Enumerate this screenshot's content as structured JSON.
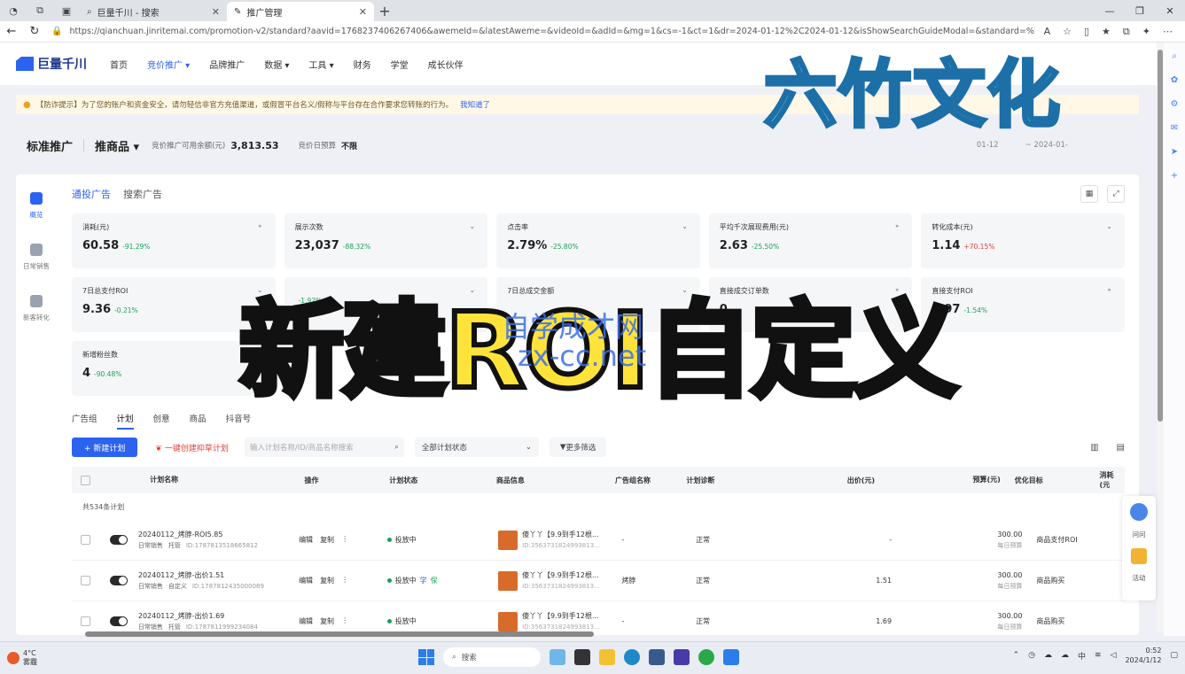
{
  "browser": {
    "tabs": [
      {
        "label": "巨量千川 - 搜索",
        "active": false
      },
      {
        "label": "推广管理",
        "active": true
      }
    ],
    "url": "https://qianchuan.jinritemai.com/promotion-v2/standard?aavid=1768237406267406&awemeId=&latestAweme=&videoId=&adId=&mg=1&cs=-1&ct=1&dr=2024-01-12%2C2024-01-12&isShowSearchGuideModal=&standard=%7B\"t..."
  },
  "app": {
    "logo_text": "巨量千川",
    "menu": [
      "首页",
      "竞价推广 ▾",
      "品牌推广",
      "数据 ▾",
      "工具 ▾",
      "财务",
      "学堂",
      "成长伙伴"
    ],
    "menu_active_index": 1
  },
  "notice": {
    "text": "【防诈提示】为了您的账户和资金安全，请勿轻信非官方充值渠道，或假冒平台名义/假称与平台存在合作要求您转账的行为。",
    "link": "我知道了"
  },
  "account": {
    "mode": "标准推广",
    "type": "推商品 ▾",
    "balance_label": "竞价推广可用余额(元)",
    "balance_value": "3,813.53",
    "budget_label": "竞价日预算",
    "budget_value": "不限",
    "date_start": "01-12",
    "date_end": "~ 2024-01-"
  },
  "leftnav": [
    {
      "label": "概览",
      "active": true
    },
    {
      "label": "日常销售",
      "active": false
    },
    {
      "label": "新客转化",
      "active": false
    }
  ],
  "subtabs": [
    "通投广告",
    "搜索广告"
  ],
  "metrics": [
    {
      "label": "消耗(元)",
      "value": "60.58",
      "change": "-91.29%",
      "dir": "down"
    },
    {
      "label": "展示次数",
      "value": "23,037",
      "change": "-88.32%",
      "dir": "down"
    },
    {
      "label": "点击率",
      "value": "2.79%",
      "change": "-25.80%",
      "dir": "down"
    },
    {
      "label": "平均千次展现费用(元)",
      "value": "2.63",
      "change": "-25.50%",
      "dir": "down"
    },
    {
      "label": "转化成本(元)",
      "value": "1.14",
      "change": "+70.15%",
      "dir": "up"
    },
    {
      "label": "7日总支付ROI",
      "value": "9.36",
      "change": "-0.21%",
      "dir": "down"
    },
    {
      "label": "",
      "value": "",
      "change": "-1.92%",
      "dir": "down"
    },
    {
      "label": "7日总成交金额",
      "value": "",
      "change": "",
      "dir": "down"
    },
    {
      "label": "直接成交订单数",
      "value": "0",
      "change": "",
      "dir": "down"
    },
    {
      "label": "直接支付ROI",
      "value": "8.97",
      "change": "-1.54%",
      "dir": "down"
    },
    {
      "label": "新增粉丝数",
      "value": "4",
      "change": "-90.48%",
      "dir": "down"
    }
  ],
  "table_tabs": [
    "广告组",
    "计划",
    "创意",
    "商品",
    "抖音号"
  ],
  "table_tab_active": 1,
  "toolbar": {
    "new_button": "+ 新建计划",
    "batch_button": "一键创建抑草计划",
    "search_placeholder": "输入计划名称/ID/商品名称搜索",
    "status_select": "全部计划状态",
    "more_filter": "更多筛选"
  },
  "table": {
    "headers": [
      "计划名称",
      "操作",
      "计划状态",
      "商品信息",
      "广告组名称",
      "计划诊断",
      "出价(元)",
      "预算(元)",
      "优化目标",
      "消耗(元"
    ],
    "count_text": "共534条计划",
    "rows": [
      {
        "name": "20240112_烤脖-ROI5.85",
        "tag1": "日常销售",
        "tag2": "托管",
        "id": "ID:1787813518665812",
        "ops": [
          "编辑",
          "复制",
          "⋮"
        ],
        "status": "投放中",
        "badges": [],
        "product": "傻丫丫【9.9到手12根...",
        "pid": "ID:3563731824993813...",
        "group": "-",
        "diag": "正常",
        "bid": "-",
        "budget": "300.00",
        "budget_period": "每日预算",
        "goal": "商品支付ROI"
      },
      {
        "name": "20240112_烤脖-出价1.51",
        "tag1": "日常销售",
        "tag2": "自定义",
        "id": "ID:1787812435000089",
        "ops": [
          "编辑",
          "复制",
          "⋮"
        ],
        "status": "投放中",
        "badges": [
          "学",
          "保"
        ],
        "product": "傻丫丫【9.9到手12根...",
        "pid": "ID:3563731824993813...",
        "group": "烤脖",
        "diag": "正常",
        "bid": "1.51",
        "budget": "300.00",
        "budget_period": "每日预算",
        "goal": "商品购买"
      },
      {
        "name": "20240112_烤脖-出价1.69",
        "tag1": "日常销售",
        "tag2": "托管",
        "id": "ID:1787811999234084",
        "ops": [
          "编辑",
          "复制",
          "⋮"
        ],
        "status": "投放中",
        "badges": [],
        "product": "傻丫丫【9.9到手12根...",
        "pid": "ID:3563731824993813...",
        "group": "-",
        "diag": "正常",
        "bid": "1.69",
        "budget": "300.00",
        "budget_period": "每日预算",
        "goal": "商品购买"
      }
    ]
  },
  "helpfloat": {
    "ask": "问问",
    "activity": "活动"
  },
  "overlay": {
    "top_watermark": "六竹文化",
    "caption": "新建ROI自定义",
    "mid_watermark_1": "自学成才网",
    "mid_watermark_2": "zx-cc.net"
  },
  "taskbar": {
    "weather_temp": "4°C",
    "weather_desc": "雾霾",
    "search": "搜索",
    "time": "0:52",
    "date": "2024/1/12",
    "ime": "中"
  },
  "colors": {
    "accent": "#2b63f0",
    "up": "#e0403a",
    "down": "#1aa05a",
    "caption": "#ffe33a",
    "watermark": "#87d4f5"
  }
}
